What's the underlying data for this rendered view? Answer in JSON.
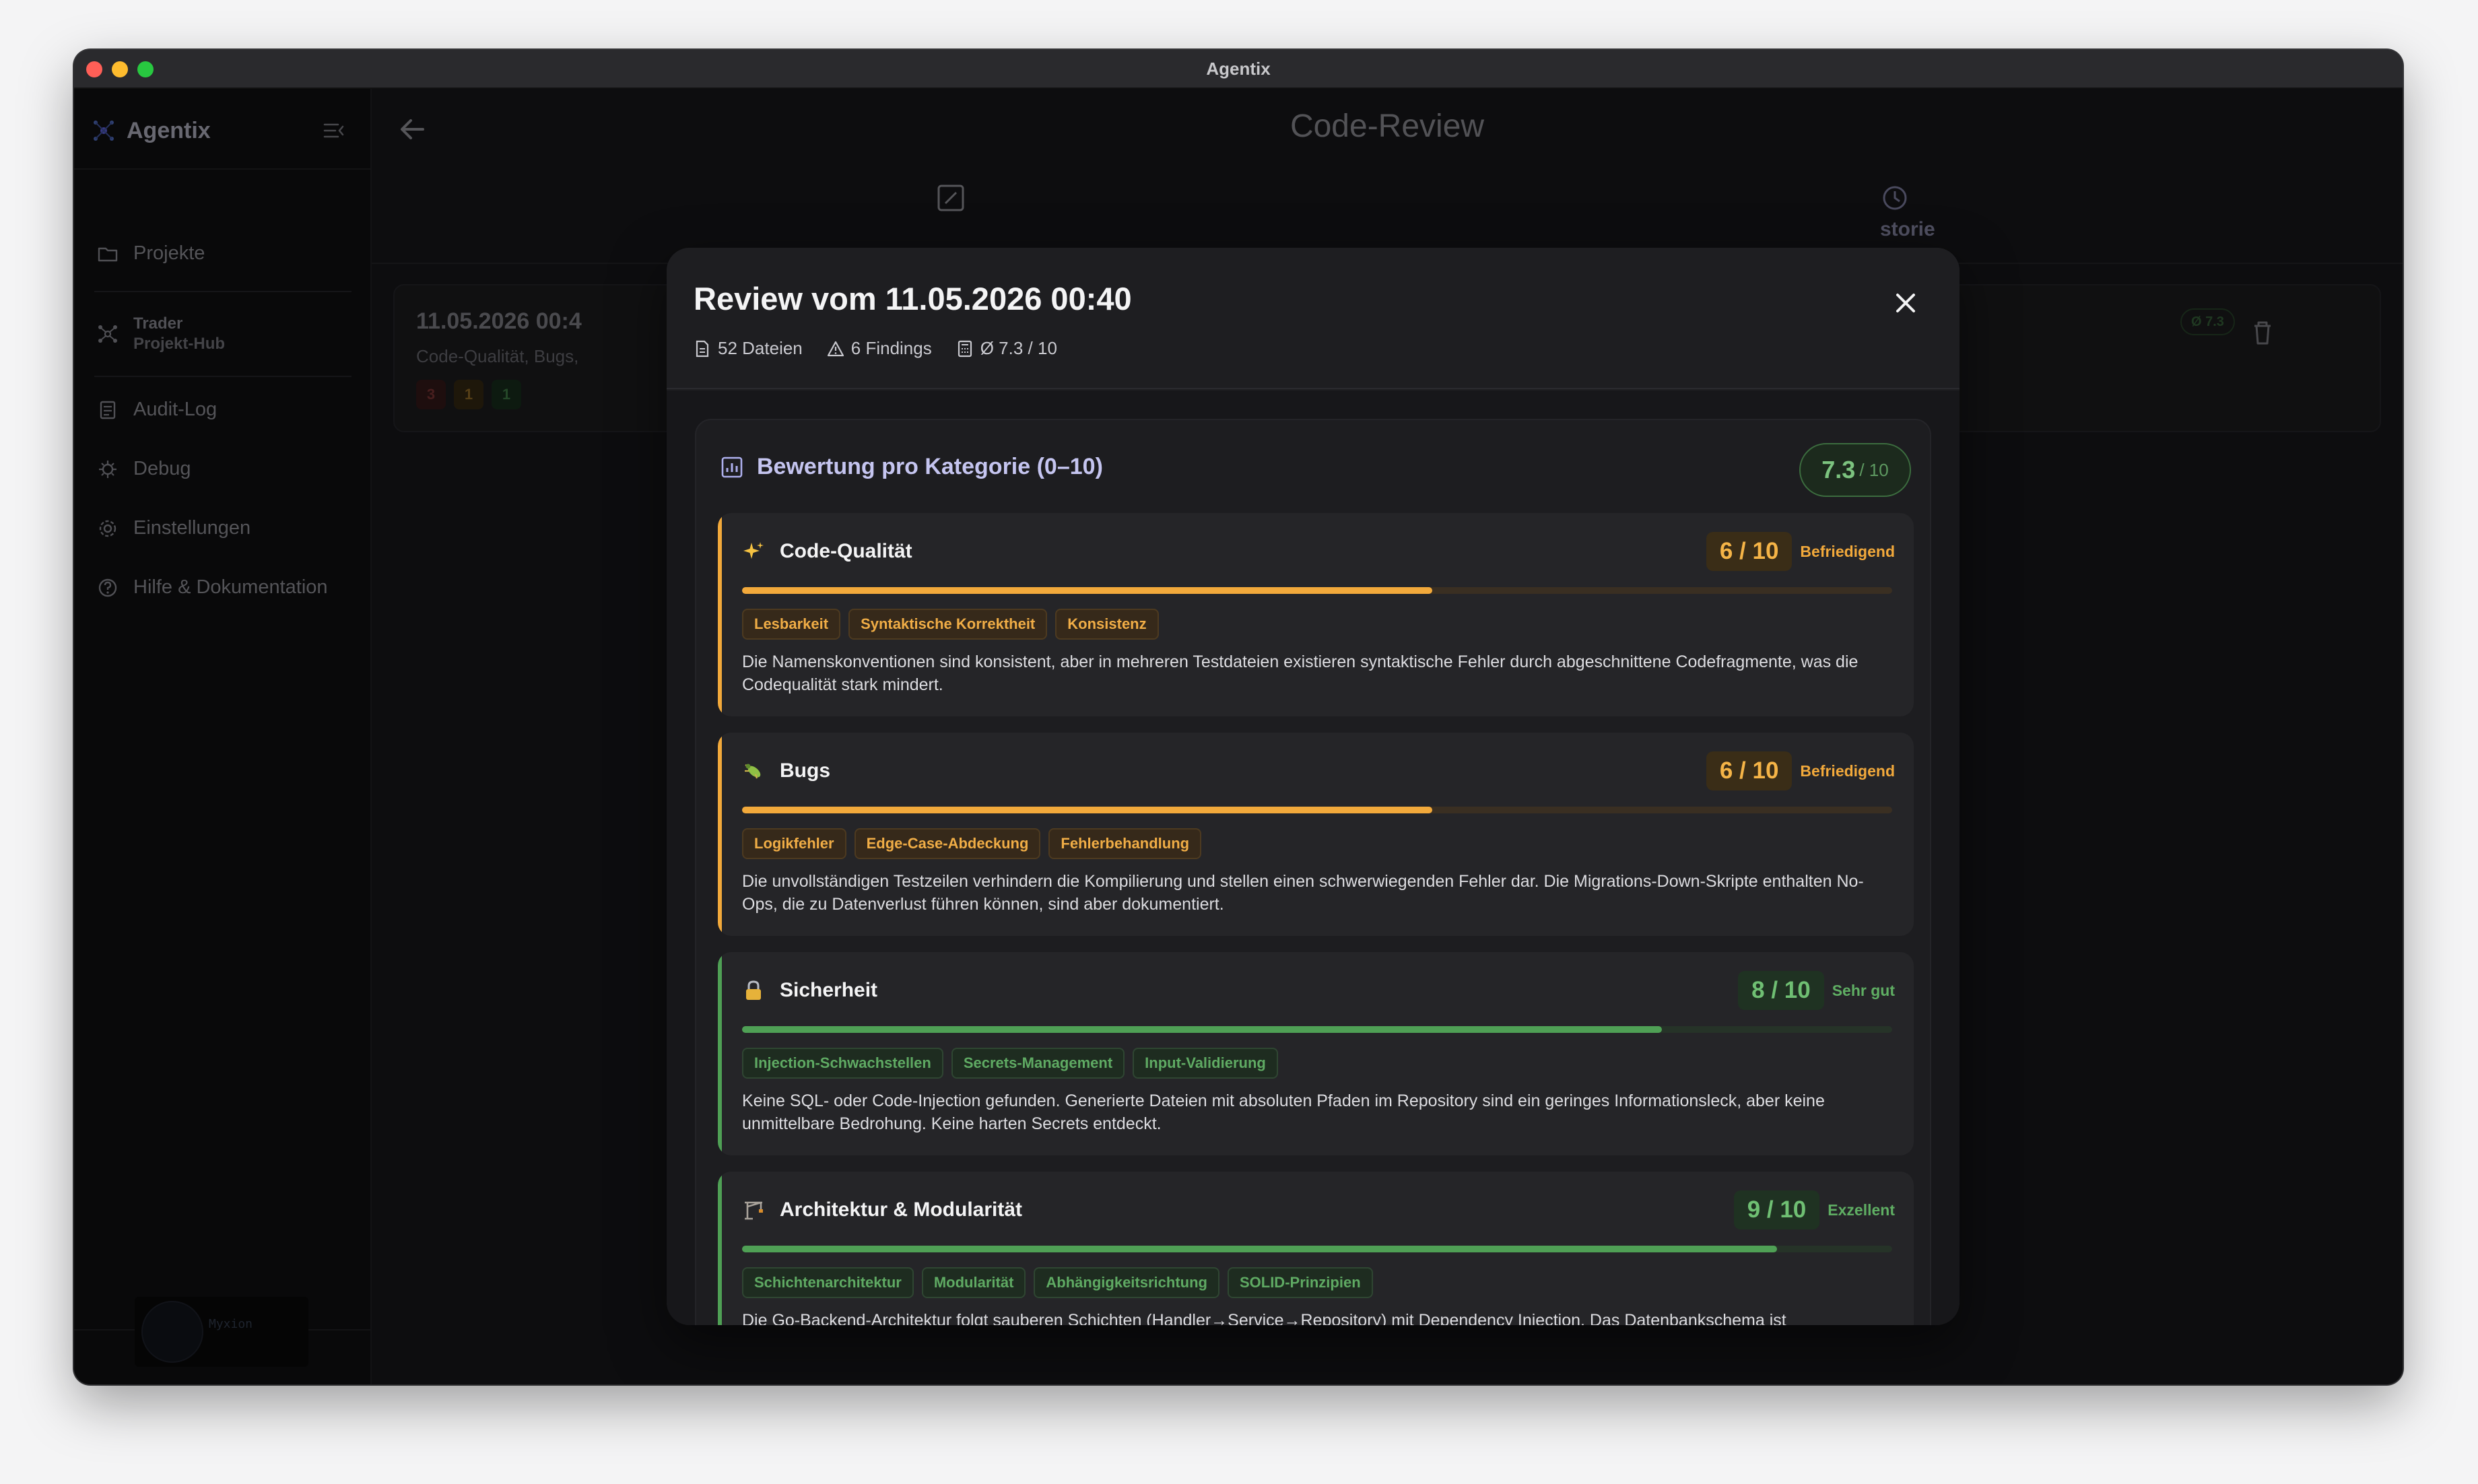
{
  "window": {
    "title": "Agentix"
  },
  "sidebar": {
    "brand": "Agentix",
    "items": [
      {
        "label": "Projekte"
      },
      {
        "label": "Trader",
        "sub": "Projekt-Hub"
      },
      {
        "label": "Audit-Log"
      },
      {
        "label": "Debug"
      },
      {
        "label": "Einstellungen"
      },
      {
        "label": "Hilfe & Dokumentation"
      }
    ],
    "user": {
      "name": "Myxion"
    }
  },
  "main": {
    "title": "Code-Review",
    "history_tab": "storie",
    "list_item": {
      "date": "11.05.2026 00:4",
      "categories": "Code-Qualität, Bugs,",
      "badges": [
        "3",
        "1",
        "1"
      ],
      "score": "Ø 7.3"
    }
  },
  "modal": {
    "title": "Review vom 11.05.2026 00:40",
    "meta": {
      "files": "52 Dateien",
      "findings": "6 Findings",
      "avg": "Ø 7.3 / 10"
    },
    "panel": {
      "title": "Bewertung pro Kategorie (0–10)",
      "score_value": "7.3",
      "score_out_of": "/ 10"
    },
    "categories": [
      {
        "name": "Code-Qualität",
        "icon": "sparkles-icon",
        "score": 6,
        "score_text": "6 / 10",
        "rating": "Befriedigend",
        "color": "#f2a93b",
        "tags": [
          "Lesbarkeit",
          "Syntaktische Korrektheit",
          "Konsistenz"
        ],
        "description": "Die Namenskonventionen sind konsistent, aber in mehreren Testdateien existieren syntaktische Fehler durch abgeschnittene Codefragmente, was die Codequalität stark mindert."
      },
      {
        "name": "Bugs",
        "icon": "bug-icon",
        "score": 6,
        "score_text": "6 / 10",
        "rating": "Befriedigend",
        "color": "#f2a93b",
        "tags": [
          "Logikfehler",
          "Edge-Case-Abdeckung",
          "Fehlerbehandlung"
        ],
        "description": "Die unvollständigen Testzeilen verhindern die Kompilierung und stellen einen schwerwiegenden Fehler dar. Die Migrations-Down-Skripte enthalten No-Ops, die zu Datenverlust führen können, sind aber dokumentiert."
      },
      {
        "name": "Sicherheit",
        "icon": "lock-icon",
        "score": 8,
        "score_text": "8 / 10",
        "rating": "Sehr gut",
        "color": "#4fa055",
        "tags": [
          "Injection-Schwachstellen",
          "Secrets-Management",
          "Input-Validierung"
        ],
        "description": "Keine SQL- oder Code-Injection gefunden. Generierte Dateien mit absoluten Pfaden im Repository sind ein geringes Informationsleck, aber keine unmittelbare Bedrohung. Keine harten Secrets entdeckt."
      },
      {
        "name": "Architektur & Modularität",
        "icon": "construction-icon",
        "score": 9,
        "score_text": "9 / 10",
        "rating": "Exzellent",
        "color": "#4fa055",
        "tags": [
          "Schichtenarchitektur",
          "Modularität",
          "Abhängigkeitsrichtung",
          "SOLID-Prinzipien"
        ],
        "description": "Die Go-Backend-Architektur folgt sauberen Schichten (Handler→Service→Repository) mit Dependency Injection. Das Datenbankschema ist"
      }
    ]
  }
}
